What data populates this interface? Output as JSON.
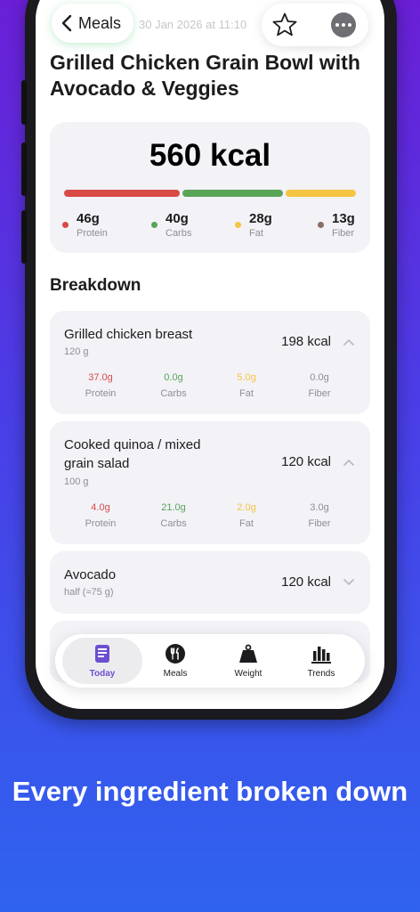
{
  "header": {
    "back_label": "Meals",
    "date_text": "30 Jan 2026 at 11:10"
  },
  "meal": {
    "title": "Grilled Chicken Grain Bowl with Avocado & Veggies",
    "total_kcal": "560 kcal",
    "macros": [
      {
        "value": "46g",
        "label": "Protein",
        "color": "#d94a46"
      },
      {
        "value": "40g",
        "label": "Carbs",
        "color": "#5aa457"
      },
      {
        "value": "28g",
        "label": "Fat",
        "color": "#f4c542"
      },
      {
        "value": "13g",
        "label": "Fiber",
        "color": "#8b6f64"
      }
    ]
  },
  "breakdown": {
    "title": "Breakdown",
    "items": [
      {
        "name": "Grilled chicken breast",
        "qty": "120 g",
        "kcal": "198 kcal",
        "expanded": true,
        "macros": [
          {
            "value": "37.0g",
            "label": "Protein"
          },
          {
            "value": "0.0g",
            "label": "Carbs"
          },
          {
            "value": "5.0g",
            "label": "Fat"
          },
          {
            "value": "0.0g",
            "label": "Fiber"
          }
        ]
      },
      {
        "name": "Cooked quinoa / mixed grain salad",
        "qty": "100 g",
        "kcal": "120 kcal",
        "expanded": true,
        "macros": [
          {
            "value": "4.0g",
            "label": "Protein"
          },
          {
            "value": "21.0g",
            "label": "Carbs"
          },
          {
            "value": "2.0g",
            "label": "Fat"
          },
          {
            "value": "3.0g",
            "label": "Fiber"
          }
        ]
      },
      {
        "name": "Avocado",
        "qty": "half (≈75 g)",
        "kcal": "120 kcal",
        "expanded": false
      }
    ]
  },
  "colors": {
    "protein": "#d94a46",
    "carbs": "#5aa457",
    "fat": "#f4c542",
    "fiber": "#8b6f64",
    "accent": "#6c4fd1"
  },
  "tabbar": {
    "tabs": [
      {
        "label": "Today",
        "icon": "today-icon",
        "active": true
      },
      {
        "label": "Meals",
        "icon": "meals-icon",
        "active": false
      },
      {
        "label": "Weight",
        "icon": "weight-icon",
        "active": false
      },
      {
        "label": "Trends",
        "icon": "trends-icon",
        "active": false
      }
    ]
  },
  "caption": "Every ingredient broken down"
}
